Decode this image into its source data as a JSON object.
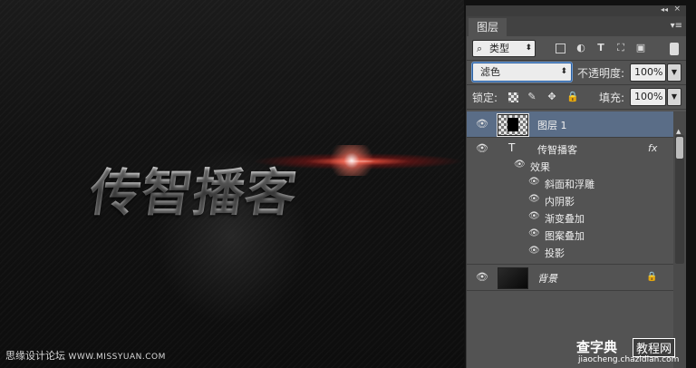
{
  "canvas": {
    "title_text": "传智播客",
    "watermark": {
      "brand": "思缘设计论坛",
      "url": "WWW.MISSYUAN.COM"
    }
  },
  "panel": {
    "tab_label": "图层",
    "filter": {
      "kind_label": "类型",
      "icons": [
        "image-filter-icon",
        "adjustment-filter-icon",
        "type-filter-icon",
        "shape-filter-icon",
        "smartobject-filter-icon"
      ]
    },
    "blend_mode": "滤色",
    "opacity": {
      "label": "不透明度:",
      "value": "100%"
    },
    "lock": {
      "label": "锁定:"
    },
    "fill": {
      "label": "填充:",
      "value": "100%"
    },
    "layers": [
      {
        "name": "图层 1",
        "type": "raster",
        "selected": true
      },
      {
        "name": "传智播客",
        "type": "text",
        "fx": "fx",
        "effects_label": "效果",
        "effects": [
          "斜面和浮雕",
          "内阴影",
          "渐变叠加",
          "图案叠加",
          "投影"
        ]
      },
      {
        "name": "背景",
        "type": "background",
        "locked": true
      }
    ]
  },
  "site_watermark": {
    "name": "查字典",
    "box": "教程网",
    "url": "jiaocheng.chazidian.com"
  },
  "colors": {
    "panel_bg": "#535353",
    "selected_layer": "#5a6d87",
    "flare_red": "#ff3b2f"
  }
}
